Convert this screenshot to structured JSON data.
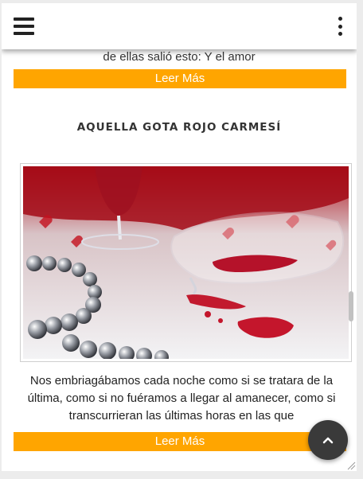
{
  "header": {
    "menu_icon": "hamburger-menu-icon",
    "more_icon": "vertical-dots-icon"
  },
  "previous_post": {
    "excerpt_tail": "de ellas salió esto:  Y el amor",
    "read_more": "Leer Más"
  },
  "post": {
    "title": "AQUELLA GOTA ROJO CARMESÍ",
    "image_icon": "wine-glasses-image",
    "excerpt": "Nos embriagábamos cada noche como si se tratara de la última, como si no fuéramos a llegar al amanecer, como si transcurrieran las últimas horas en las que",
    "read_more": "Leer Más"
  },
  "back_to_top": {
    "icon": "chevron-up-icon"
  },
  "colors": {
    "accent": "#ffa500",
    "button_dark": "#3a3a3a"
  }
}
